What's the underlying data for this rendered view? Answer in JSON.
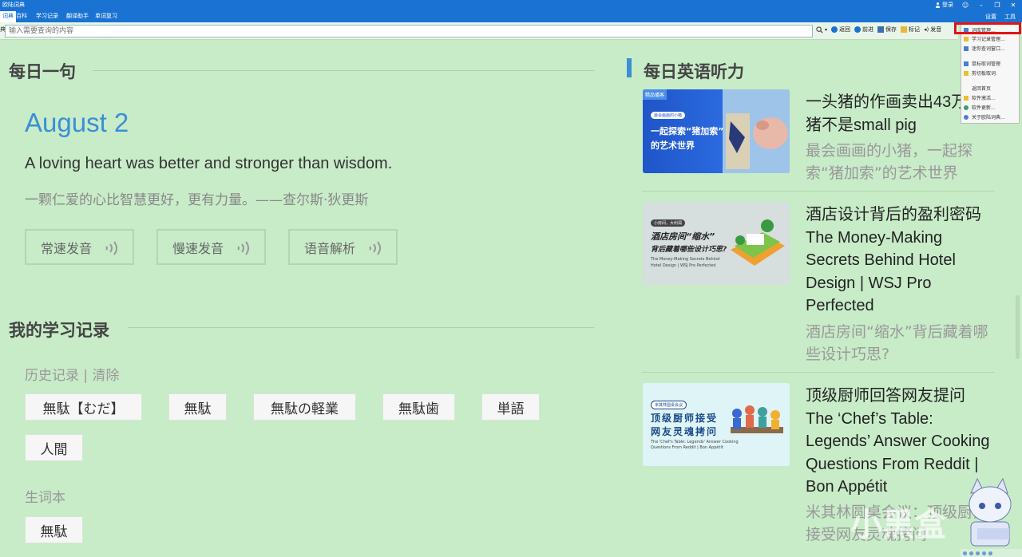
{
  "window": {
    "title": "欧陆词典",
    "login_label": "登录",
    "controls": [
      "☺",
      "–",
      "❐",
      "✕"
    ]
  },
  "tabs": [
    {
      "label": "词典",
      "active": true
    },
    {
      "label": "百科",
      "active": false
    },
    {
      "label": "学习记录",
      "active": false
    },
    {
      "label": "翻译助手",
      "active": false
    },
    {
      "label": "单词复习",
      "active": false
    }
  ],
  "tabbar_right": {
    "settings": "设置",
    "tools": "工具"
  },
  "search": {
    "left_label": "典",
    "placeholder": "输入需要查询的内容"
  },
  "toolbar": {
    "back": "返回",
    "forward": "前进",
    "save": "保存",
    "mark": "标记",
    "voice": "发音"
  },
  "dropdown_menu": [
    "词库管理...",
    "学习记录管理...",
    "迷你查词窗口...",
    "鼠标取词管理",
    "剪切板取词",
    "返回首页",
    "软件激活...",
    "软件更新...",
    "关于欧陆词典..."
  ],
  "daily_sentence": {
    "section_title": "每日一句",
    "date": "August 2",
    "english": "A loving heart was better and stronger than wisdom.",
    "chinese": "一颗仁爱的心比智慧更好，更有力量。——查尔斯·狄更斯",
    "buttons": [
      "常速发音",
      "慢速发音",
      "语音解析"
    ]
  },
  "study_record": {
    "section_title": "我的学习记录",
    "history_label": "历史记录 | 清除",
    "history_items": [
      "無駄【むだ】",
      "無駄",
      "無駄の軽業",
      "無駄歯",
      "単語",
      "人間"
    ],
    "vocab_label": "生词本",
    "vocab_items": [
      "無駄"
    ]
  },
  "listening": {
    "section_title": "每日英语听力",
    "items": [
      {
        "title": "一头猪的作画卖出43万 小猪不是small pig",
        "subtitle": "最会画画的小猪，一起探索“猪加索”的艺术世界",
        "thumb_badge": "精品播客",
        "thumb_pill": "最会画画的小猪",
        "thumb_line1": "一起探索“猪加索”",
        "thumb_line2": "的艺术世界"
      },
      {
        "title": "酒店设计背后的盈利密码 The Money-Making Secrets Behind Hotel Design | WSJ Pro Perfected",
        "subtitle": "酒店房间“缩水”背后藏着哪些设计巧思?",
        "thumb_pill": "小房间，大利润",
        "thumb_line1": "酒店房间“缩水”",
        "thumb_line2": "背后藏着哪些设计巧思?",
        "thumb_en1": "The Money-Making Secrets Behind",
        "thumb_en2": "Hotel Design | WSJ Pro Perfected"
      },
      {
        "title": "顶级厨师回答网友提问 The ‘Chef’s Table: Legends’ Answer Cooking Questions From Reddit | Bon Appétit",
        "subtitle": "米其林圆桌会议：顶级厨师接受网友灵魂拷问",
        "thumb_pill": "米其林圆桌会议",
        "thumb_line1": "顶级厨师接受",
        "thumb_line2": "网友灵魂拷问",
        "thumb_en1": "The 'Chef's Table: Legends' Answer Cooking",
        "thumb_en2": "Questions From Reddit | Bon Appétit"
      }
    ]
  },
  "watermark": "小黑盒"
}
